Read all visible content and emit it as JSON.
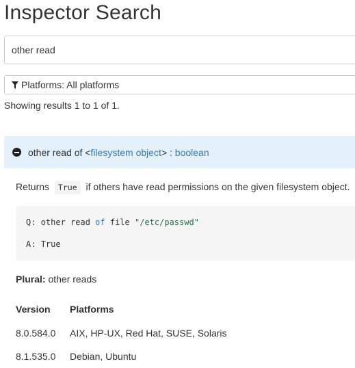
{
  "page": {
    "title": "Inspector Search"
  },
  "search": {
    "value": "other read"
  },
  "filter": {
    "label": "Platforms: All platforms"
  },
  "results": {
    "summary": "Showing results 1 to 1 of 1."
  },
  "result": {
    "prefix": "other read of <",
    "arg": "filesystem object",
    "mid": "> : ",
    "type": "boolean",
    "desc_before": "Returns",
    "desc_code": "True",
    "desc_after": "if others have read permissions on the given filesystem object.",
    "example": {
      "q_label": "Q:",
      "q_text": "other read",
      "q_kw": "of",
      "q_text2": "file",
      "q_str": "\"/etc/passwd\"",
      "a_label": "A:",
      "a_value": "True"
    },
    "plural_label": "Plural:",
    "plural_value": "other reads",
    "versions": {
      "headers": [
        "Version",
        "Platforms"
      ],
      "rows": [
        [
          "8.0.584.0",
          "AIX, HP-UX, Red Hat, SUSE, Solaris"
        ],
        [
          "8.1.535.0",
          "Debian, Ubuntu"
        ]
      ]
    }
  },
  "icons": {
    "filter": "filter-funnel-icon",
    "collapse": "minus-circle-icon"
  }
}
